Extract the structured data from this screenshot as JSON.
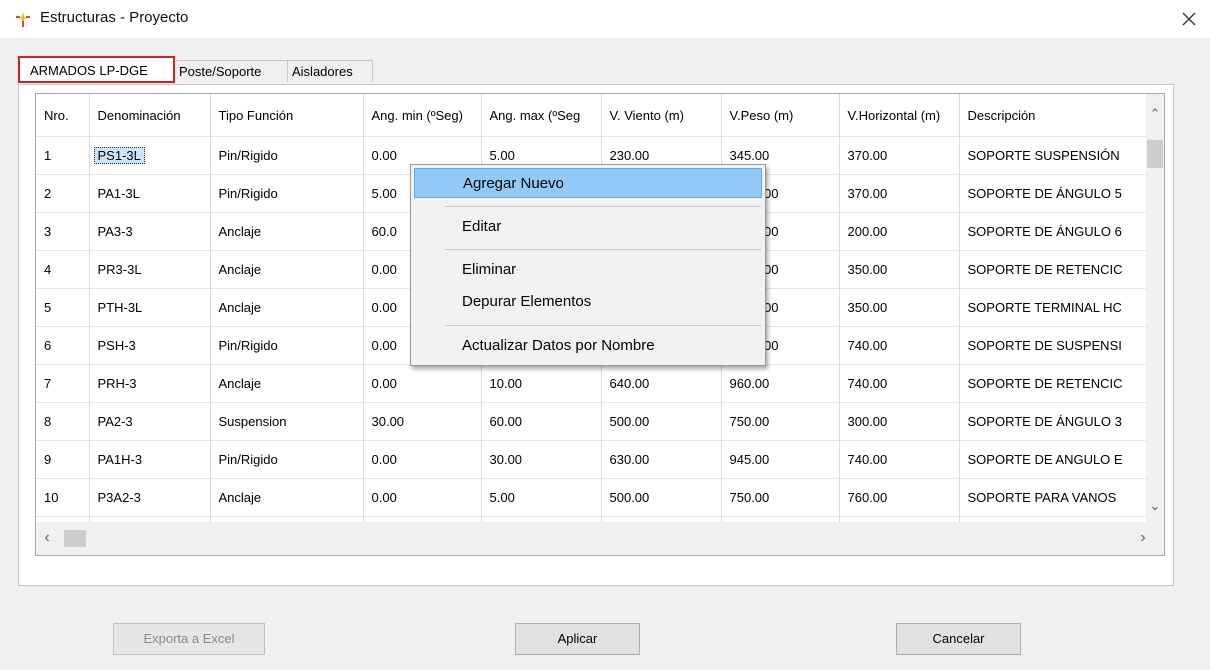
{
  "window": {
    "title": "Estructuras - Proyecto"
  },
  "tabs": [
    "ARMADOS LP-DGE",
    "Poste/Soporte",
    "Aisladores"
  ],
  "table": {
    "columns": [
      "Nro.",
      "Denominación",
      "Tipo Función",
      "Ang. min (ºSeg)",
      "Ang. max (ºSeg",
      "V. Viento (m)",
      "V.Peso (m)",
      "V.Horizontal (m)",
      "Descripción"
    ],
    "rows": [
      [
        "1",
        "PS1-3L",
        "Pin/Rigido",
        "0.00",
        "5.00",
        "230.00",
        "345.00",
        "370.00",
        "SOPORTE SUSPENSIÓN"
      ],
      [
        "2",
        "PA1-3L",
        "Pin/Rigido",
        "5.00",
        "",
        "",
        "00",
        "370.00",
        "SOPORTE DE ÁNGULO 5"
      ],
      [
        "3",
        "PA3-3",
        "Anclaje",
        "60.0",
        "",
        "",
        "00",
        "200.00",
        "SOPORTE DE ÁNGULO 6"
      ],
      [
        "4",
        "PR3-3L",
        "Anclaje",
        "0.00",
        "",
        "",
        "00",
        "350.00",
        "SOPORTE DE RETENCIC"
      ],
      [
        "5",
        "PTH-3L",
        "Anclaje",
        "0.00",
        "",
        "",
        "00",
        "350.00",
        "SOPORTE TERMINAL HC"
      ],
      [
        "6",
        "PSH-3",
        "Pin/Rigido",
        "0.00",
        "",
        "",
        "00",
        "740.00",
        "SOPORTE DE SUSPENSI"
      ],
      [
        "7",
        "PRH-3",
        "Anclaje",
        "0.00",
        "10.00",
        "640.00",
        "960.00",
        "740.00",
        "SOPORTE DE RETENCIC"
      ],
      [
        "8",
        "PA2-3",
        "Suspension",
        "30.00",
        "60.00",
        "500.00",
        "750.00",
        "300.00",
        "SOPORTE DE ÁNGULO 3"
      ],
      [
        "9",
        "PA1H-3",
        "Pin/Rigido",
        "0.00",
        "30.00",
        "630.00",
        "945.00",
        "740.00",
        "SOPORTE DE ANGULO E"
      ],
      [
        "10",
        "P3A2-3",
        "Anclaje",
        "0.00",
        "5.00",
        "500.00",
        "750.00",
        "760.00",
        "SOPORTE PARA VANOS"
      ]
    ]
  },
  "context_menu": {
    "items": [
      "Agregar Nuevo",
      "Editar",
      "Eliminar",
      "Depurar Elementos",
      "Actualizar Datos por Nombre"
    ],
    "highlighted": "Agregar Nuevo"
  },
  "buttons": {
    "export": "Exporta a Excel",
    "apply": "Aplicar",
    "cancel": "Cancelar"
  },
  "colors": {
    "active_tab_border": "#d42020",
    "menu_highlight": "#91c9f7",
    "selected_cell": "#cce4f7"
  }
}
